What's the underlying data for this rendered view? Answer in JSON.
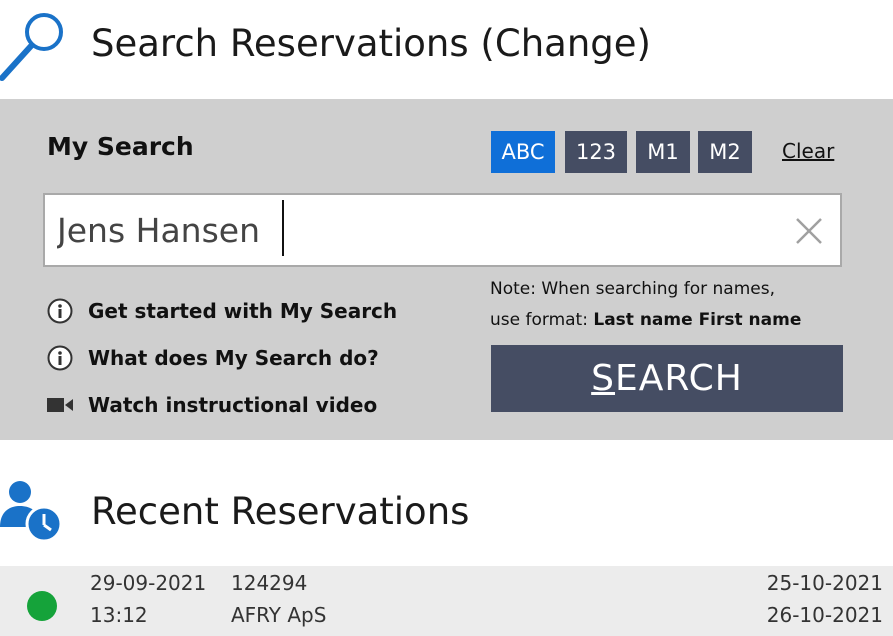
{
  "header": {
    "title": "Search Reservations (Change)",
    "icon": "search-icon"
  },
  "my_search": {
    "title": "My Search",
    "modes": [
      {
        "label": "ABC",
        "active": true
      },
      {
        "label": "123",
        "active": false
      },
      {
        "label": "M1",
        "active": false
      },
      {
        "label": "M2",
        "active": false
      }
    ],
    "clear_label": "Clear",
    "input_value": "Jens Hansen",
    "help_links": [
      {
        "label": "Get started with My Search",
        "icon": "info-icon"
      },
      {
        "label": "What does My Search do?",
        "icon": "info-icon"
      },
      {
        "label": "Watch instructional video",
        "icon": "video-camera-icon"
      }
    ],
    "note_line1": "Note: When searching for names,",
    "note_prefix": "use format: ",
    "note_format": "Last name First name",
    "search_button_label": "SEARCH"
  },
  "recent": {
    "title": "Recent Reservations",
    "icon": "user-clock-icon",
    "rows": [
      {
        "status": "green",
        "created_date": "29-09-2021",
        "created_time": "13:12",
        "number": "124294",
        "company": "AFRY ApS",
        "from_date": "25-10-2021",
        "to_date": "26-10-2021"
      }
    ]
  },
  "colors": {
    "accent": "#0f6fd8",
    "button_dark": "#454d63",
    "panel_bg": "#cfcfcf",
    "status_green": "#15a33a",
    "icon_blue": "#1a72c8"
  }
}
